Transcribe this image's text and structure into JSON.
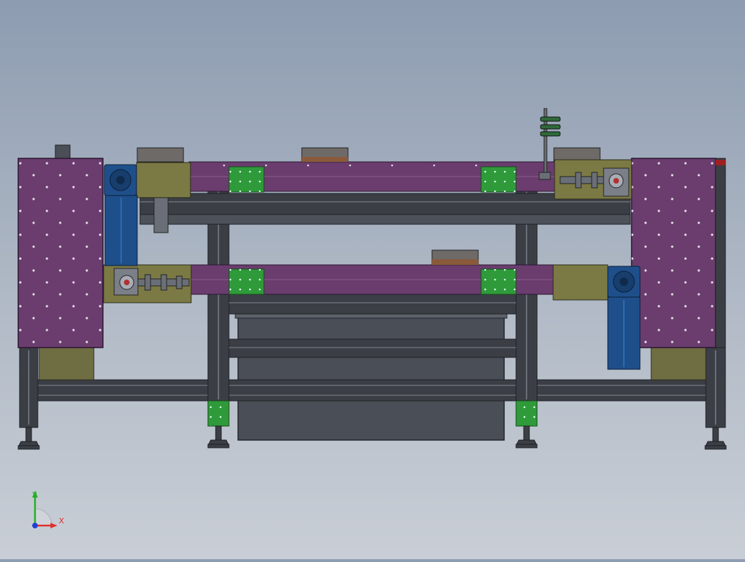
{
  "viewport": {
    "background_top": "#8d9cb1",
    "background_bottom": "#c9ced6"
  },
  "colors": {
    "purple_panel": "#6a3d6e",
    "frame": "#3b3f45",
    "frame_light": "#5a5f66",
    "olive": "#7c7a44",
    "green_block": "#2f9a3a",
    "motor_blue": "#1e4f8a",
    "tray": "#4a4e56",
    "roller": "#8a7b6e"
  },
  "triad": {
    "x_label": "X",
    "y_label": "Y",
    "x_color": "#e03030",
    "y_color": "#20b020",
    "z_color": "#2040d0"
  }
}
